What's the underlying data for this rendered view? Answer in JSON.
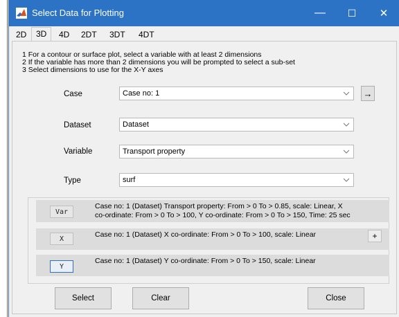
{
  "window": {
    "title": "Select Data for Plotting",
    "controls": {
      "minimize": "—",
      "maximize": "☐",
      "close": "✕"
    },
    "titlebar_color": "#2d73c5"
  },
  "tabs": [
    {
      "label": "2D",
      "active": false
    },
    {
      "label": "3D",
      "active": true
    },
    {
      "label": "4D",
      "active": false
    },
    {
      "label": "2DT",
      "active": false
    },
    {
      "label": "3DT",
      "active": false
    },
    {
      "label": "4DT",
      "active": false
    }
  ],
  "instructions": [
    "1 For a contour or surface plot, select a variable with at least 2 dimensions",
    "2 If the variable has more than 2 dimensions you will be prompted to select a sub-set",
    "3 Select dimensions to use for the X-Y axes"
  ],
  "fields": {
    "case": {
      "label": "Case",
      "value": "Case no: 1",
      "action": "→"
    },
    "dataset": {
      "label": "Dataset",
      "value": "Dataset"
    },
    "variable": {
      "label": "Variable",
      "value": "Transport property"
    },
    "type": {
      "label": "Type",
      "value": "surf"
    }
  },
  "axes": {
    "var": {
      "button": "Var",
      "line1": "Case no: 1 (Dataset) Transport property: From > 0 To > 0.85, scale: Linear, X",
      "line2": "co-ordinate: From > 0 To > 100, Y co-ordinate: From > 0 To > 150, Time: 25 sec"
    },
    "x": {
      "button": "X",
      "line1": "Case no: 1 (Dataset) X co-ordinate: From > 0 To > 100, scale: Linear",
      "add": "+"
    },
    "y": {
      "button": "Y",
      "line1": "Case no: 1 (Dataset) Y co-ordinate: From > 0 To > 150, scale: Linear"
    }
  },
  "buttons": {
    "select": "Select",
    "clear": "Clear",
    "close": "Close"
  }
}
